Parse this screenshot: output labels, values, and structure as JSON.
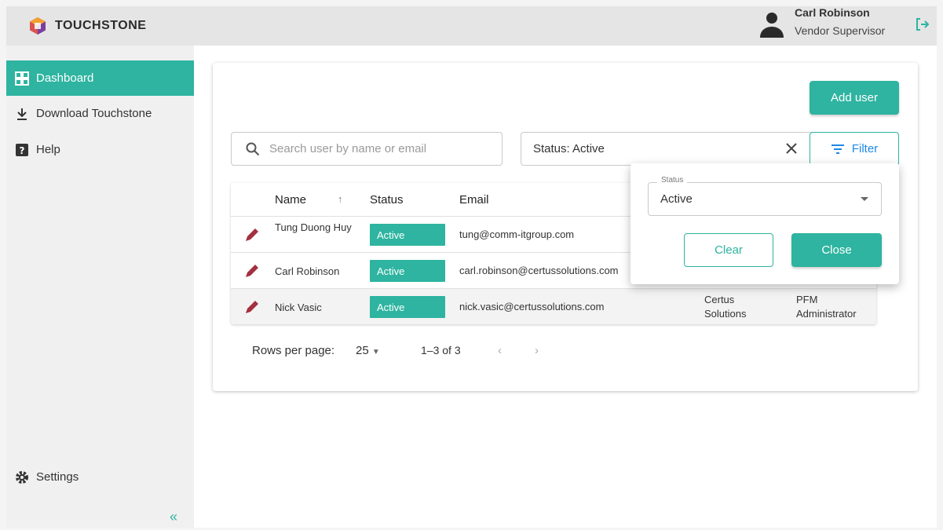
{
  "app": {
    "logo_text": "TOUCHSTONE"
  },
  "user": {
    "name": "Carl Robinson",
    "role": "Vendor Supervisor"
  },
  "sidebar": {
    "items": [
      {
        "label": "Dashboard",
        "icon": "dashboard-icon",
        "active": true
      },
      {
        "label": "Download Touchstone",
        "icon": "download-icon",
        "active": false
      },
      {
        "label": "Help",
        "icon": "help-icon",
        "active": false
      }
    ],
    "settings_label": "Settings",
    "collapse_icon": "«"
  },
  "toolbar": {
    "add_user_label": "Add user",
    "search_placeholder": "Search user by name or email",
    "status_chip_label": "Status: Active",
    "filter_label": "Filter"
  },
  "table": {
    "columns": [
      "Name",
      "Status",
      "Email"
    ],
    "rows": [
      {
        "name": "Tung Duong Huy",
        "status": "Active",
        "email": "tung@comm-itgroup.com",
        "company": "",
        "role": ""
      },
      {
        "name": "Carl Robinson",
        "status": "Active",
        "email": "carl.robinson@certussolutions.com",
        "company": "",
        "role": ""
      },
      {
        "name": "Nick Vasic",
        "status": "Active",
        "email": "nick.vasic@certussolutions.com",
        "company": "Certus Solutions",
        "role": "PFM Administrator"
      }
    ]
  },
  "pagination": {
    "rows_per_page_label": "Rows per page:",
    "rows_per_page_value": "25",
    "range": "1–3 of 3"
  },
  "filter_popup": {
    "status_label": "Status",
    "status_value": "Active",
    "clear_label": "Clear",
    "close_label": "Close"
  },
  "colors": {
    "accent": "#2eb4a0",
    "edit_icon": "#a3303f",
    "filter_text": "#1e88e5"
  }
}
